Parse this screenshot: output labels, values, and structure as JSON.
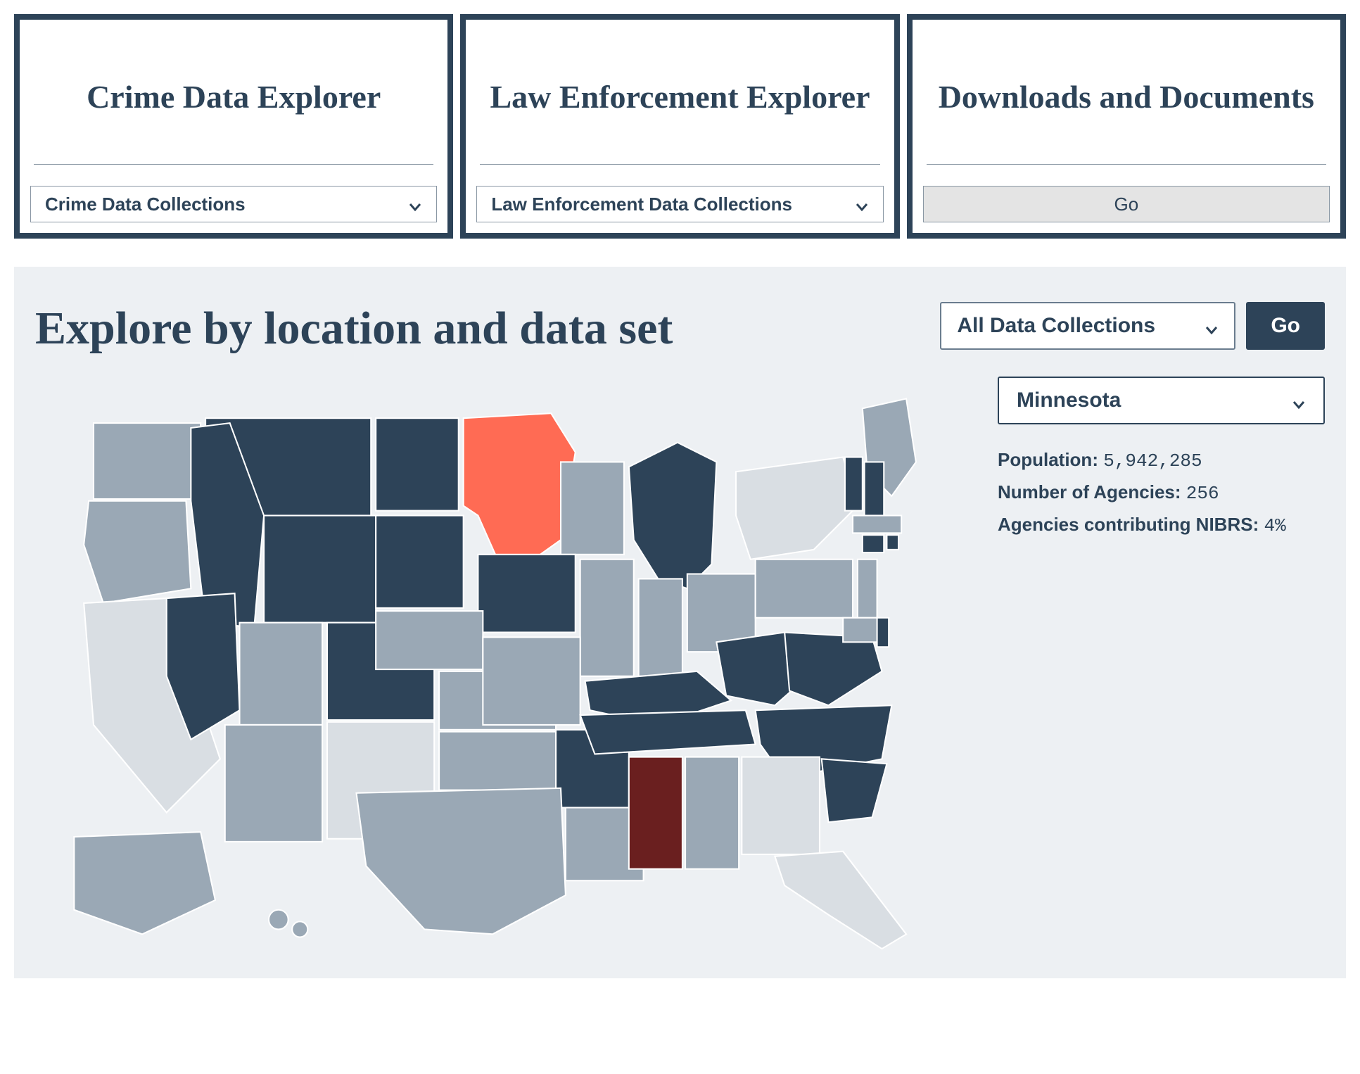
{
  "cards": [
    {
      "title": "Crime Data Explorer",
      "dropdown": "Crime Data Collections"
    },
    {
      "title": "Law Enforcement Explorer",
      "dropdown": "Law Enforcement Data Collections"
    },
    {
      "title": "Downloads and Documents",
      "button": "Go"
    }
  ],
  "explore": {
    "title": "Explore by location and data set",
    "dataset_select": "All Data Collections",
    "go_label": "Go",
    "state_select": "Minnesota",
    "stats": {
      "population_label": "Population:",
      "population_value": "5,942,285",
      "agencies_label": "Number of Agencies:",
      "agencies_value": "256",
      "nibrs_label": "Agencies contributing NIBRS:",
      "nibrs_value": "4%"
    }
  },
  "map": {
    "selected_state": "Minnesota",
    "highlighted_state": "Mississippi",
    "colors": {
      "light": "#d9dee3",
      "medium": "#9aa8b5",
      "dark": "#2d4358",
      "selected": "#ff6b54",
      "highlighted": "#6a1f1f"
    },
    "state_shades": {
      "WA": "med",
      "OR": "med",
      "CA": "light",
      "NV": "dark",
      "ID": "dark",
      "MT": "dark",
      "WY": "dark",
      "UT": "med",
      "AZ": "med",
      "NM": "light",
      "CO": "dark",
      "ND": "dark",
      "SD": "dark",
      "NE": "med",
      "KS": "med",
      "OK": "med",
      "TX": "med",
      "MN": "red",
      "IA": "dark",
      "MO": "med",
      "AR": "dark",
      "LA": "med",
      "WI": "med",
      "IL": "med",
      "MI": "dark",
      "IN": "med",
      "OH": "med",
      "KY": "dark",
      "TN": "dark",
      "MS": "maroon",
      "AL": "med",
      "GA": "light",
      "FL": "light",
      "SC": "dark",
      "NC": "dark",
      "VA": "dark",
      "WV": "dark",
      "PA": "med",
      "NY": "light",
      "ME": "med",
      "VT": "dark",
      "NH": "dark",
      "MA": "med",
      "RI": "dark",
      "CT": "dark",
      "NJ": "med",
      "DE": "dark",
      "MD": "med",
      "AK": "med",
      "HI": "med"
    }
  }
}
